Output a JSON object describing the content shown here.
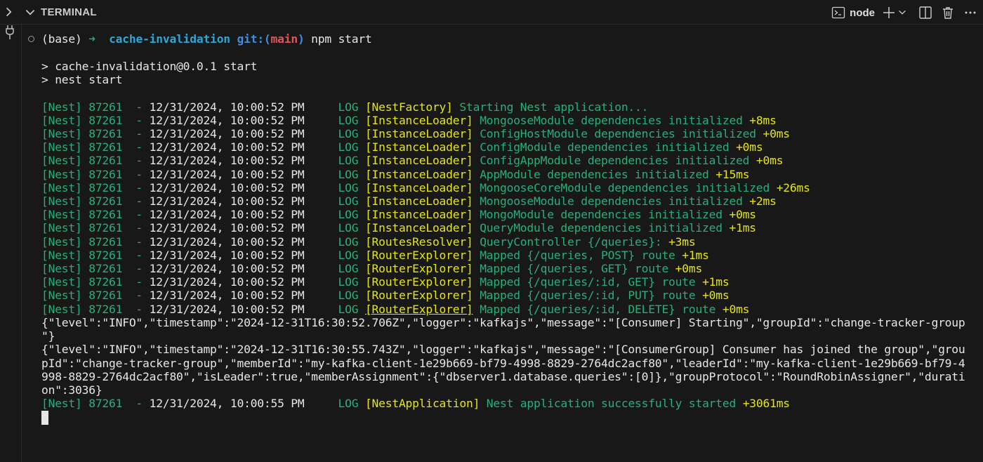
{
  "header": {
    "title": "TERMINAL",
    "shell_label": "node",
    "icons": [
      "chevron-right-icon",
      "chevron-down-icon",
      "terminal-icon",
      "plus-icon",
      "chevron-down-icon",
      "split-icon",
      "trash-icon",
      "more-icon"
    ]
  },
  "colors": {
    "green": "#26b079",
    "yellow": "#e5e510",
    "cyan": "#2ea6d6",
    "red": "#e0555a",
    "background": "#181818"
  },
  "prompt": {
    "env": "(base)",
    "arrow": "➜",
    "dir": "cache-invalidation",
    "git_label": "git:(",
    "branch": "main",
    "git_close": ")",
    "command": "npm start"
  },
  "npm_output": [
    "> cache-invalidation@0.0.1 start",
    "> nest start"
  ],
  "log_prefix": "[Nest] 87261  - ",
  "logs": [
    {
      "ts": "12/31/2024, 10:00:52 PM",
      "level": "LOG",
      "ctx": "[NestFactory]",
      "msg": "Starting Nest application...",
      "dur": ""
    },
    {
      "ts": "12/31/2024, 10:00:52 PM",
      "level": "LOG",
      "ctx": "[InstanceLoader]",
      "msg": "MongooseModule dependencies initialized",
      "dur": "+8ms"
    },
    {
      "ts": "12/31/2024, 10:00:52 PM",
      "level": "LOG",
      "ctx": "[InstanceLoader]",
      "msg": "ConfigHostModule dependencies initialized",
      "dur": "+0ms"
    },
    {
      "ts": "12/31/2024, 10:00:52 PM",
      "level": "LOG",
      "ctx": "[InstanceLoader]",
      "msg": "ConfigModule dependencies initialized",
      "dur": "+0ms"
    },
    {
      "ts": "12/31/2024, 10:00:52 PM",
      "level": "LOG",
      "ctx": "[InstanceLoader]",
      "msg": "ConfigAppModule dependencies initialized",
      "dur": "+0ms"
    },
    {
      "ts": "12/31/2024, 10:00:52 PM",
      "level": "LOG",
      "ctx": "[InstanceLoader]",
      "msg": "AppModule dependencies initialized",
      "dur": "+15ms"
    },
    {
      "ts": "12/31/2024, 10:00:52 PM",
      "level": "LOG",
      "ctx": "[InstanceLoader]",
      "msg": "MongooseCoreModule dependencies initialized",
      "dur": "+26ms"
    },
    {
      "ts": "12/31/2024, 10:00:52 PM",
      "level": "LOG",
      "ctx": "[InstanceLoader]",
      "msg": "MongooseModule dependencies initialized",
      "dur": "+2ms"
    },
    {
      "ts": "12/31/2024, 10:00:52 PM",
      "level": "LOG",
      "ctx": "[InstanceLoader]",
      "msg": "MongoModule dependencies initialized",
      "dur": "+0ms"
    },
    {
      "ts": "12/31/2024, 10:00:52 PM",
      "level": "LOG",
      "ctx": "[InstanceLoader]",
      "msg": "QueryModule dependencies initialized",
      "dur": "+1ms"
    },
    {
      "ts": "12/31/2024, 10:00:52 PM",
      "level": "LOG",
      "ctx": "[RoutesResolver]",
      "msg": "QueryController {/queries}:",
      "dur": "+3ms"
    },
    {
      "ts": "12/31/2024, 10:00:52 PM",
      "level": "LOG",
      "ctx": "[RouterExplorer]",
      "msg": "Mapped {/queries, POST} route",
      "dur": "+1ms"
    },
    {
      "ts": "12/31/2024, 10:00:52 PM",
      "level": "LOG",
      "ctx": "[RouterExplorer]",
      "msg": "Mapped {/queries, GET} route",
      "dur": "+0ms"
    },
    {
      "ts": "12/31/2024, 10:00:52 PM",
      "level": "LOG",
      "ctx": "[RouterExplorer]",
      "msg": "Mapped {/queries/:id, GET} route",
      "dur": "+1ms"
    },
    {
      "ts": "12/31/2024, 10:00:52 PM",
      "level": "LOG",
      "ctx": "[RouterExplorer]",
      "msg": "Mapped {/queries/:id, PUT} route",
      "dur": "+0ms"
    },
    {
      "ts": "12/31/2024, 10:00:52 PM",
      "level": "LOG",
      "ctx": "[RouterExplorer]",
      "msg": "Mapped {/queries/:id, DELETE} route",
      "dur": "+0ms"
    }
  ],
  "json_lines": [
    "{\"level\":\"INFO\",\"timestamp\":\"2024-12-31T16:30:52.706Z\",\"logger\":\"kafkajs\",\"message\":\"[Consumer] Starting\",\"groupId\":\"change-tracker-group",
    "\"}",
    "{\"level\":\"INFO\",\"timestamp\":\"2024-12-31T16:30:55.743Z\",\"logger\":\"kafkajs\",\"message\":\"[ConsumerGroup] Consumer has joined the group\",\"grou",
    "pId\":\"change-tracker-group\",\"memberId\":\"my-kafka-client-1e29b669-bf79-4998-8829-2764dc2acf80\",\"leaderId\":\"my-kafka-client-1e29b669-bf79-4",
    "998-8829-2764dc2acf80\",\"isLeader\":true,\"memberAssignment\":{\"dbserver1.database.queries\":[0]},\"groupProtocol\":\"RoundRobinAssigner\",\"durati",
    "on\":3036}"
  ],
  "final_log": {
    "ts": "12/31/2024, 10:00:55 PM",
    "level": "LOG",
    "ctx": "[NestApplication]",
    "msg": "Nest application successfully started",
    "dur": "+3061ms"
  }
}
